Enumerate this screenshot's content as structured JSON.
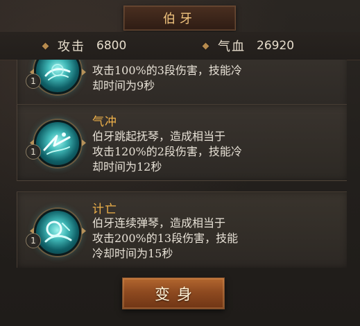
{
  "title": "伯牙",
  "stats": {
    "attack_label": "攻击",
    "attack_value": "6800",
    "hp_label": "气血",
    "hp_value": "26920"
  },
  "skills": [
    {
      "name": "",
      "level": "1",
      "desc_lines": [
        "攻击100%的3段伤害，技能冷",
        "却时间为9秒"
      ],
      "icon": "lyre-skill-icon"
    },
    {
      "name": "气冲",
      "level": "1",
      "desc_lines": [
        "伯牙跳起抚琴，造成相当于",
        "攻击120%的2段伤害，技能冷",
        "却时间为12秒"
      ],
      "icon": "wave-strike-skill-icon"
    },
    {
      "name": "计亡",
      "level": "1",
      "desc_lines": [
        "伯牙连续弹琴，造成相当于",
        "攻击200%的13段伤害，技能",
        "冷却时间为15秒"
      ],
      "icon": "guqin-skill-icon"
    }
  ],
  "transform_button": {
    "label": "变身"
  },
  "colors": {
    "accent_gold": "#f0b24a",
    "title_gold": "#f2c57f",
    "button_orange": "#8e4a20",
    "text": "#e7e1d6"
  }
}
